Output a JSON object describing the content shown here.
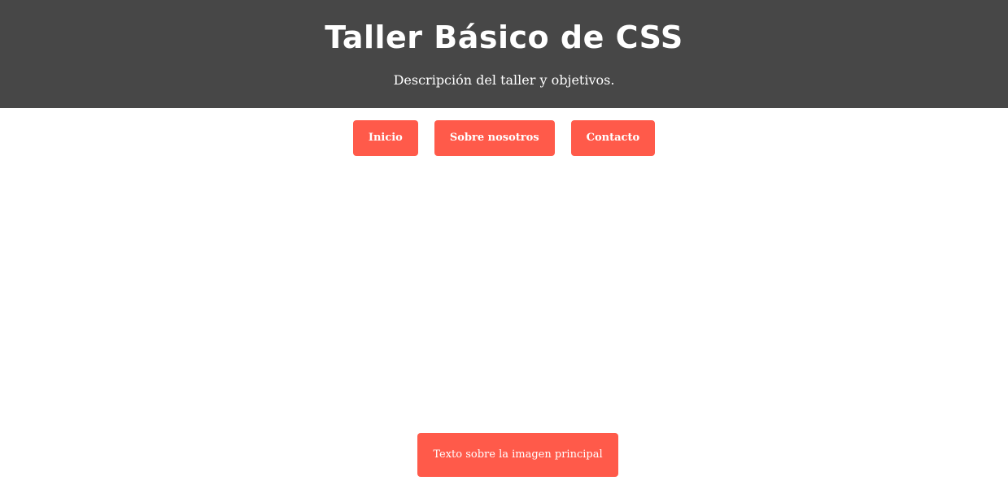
{
  "header": {
    "title": "Taller Básico de CSS",
    "description": "Descripción del taller y objetivos."
  },
  "nav": {
    "items": [
      {
        "label": "Inicio"
      },
      {
        "label": "Sobre nosotros"
      },
      {
        "label": "Contacto"
      }
    ]
  },
  "hero": {
    "overlay_text": "Texto sobre la imagen principal"
  },
  "colors": {
    "header_bg": "#474747",
    "accent": "#ff5a4a",
    "text_light": "#ffffff",
    "page_bg": "#ffffff"
  }
}
